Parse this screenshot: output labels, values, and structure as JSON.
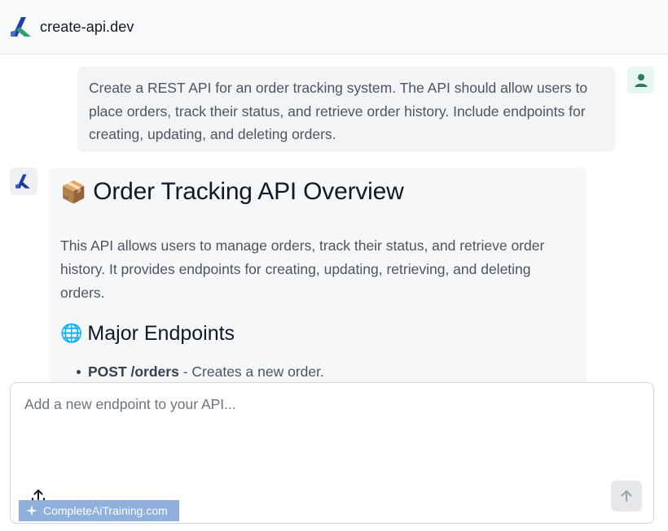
{
  "header": {
    "brand": "create-api.dev"
  },
  "conversation": {
    "user_message": "Create a REST API for an order tracking system. The API should allow users to place orders, track their status, and retrieve order history. Include endpoints for creating, updating, and deleting orders.",
    "assistant": {
      "title_emoji": "📦",
      "title": "Order Tracking API Overview",
      "description": "This API allows users to manage orders, track their status, and retrieve order history. It provides endpoints for creating, updating, retrieving, and deleting orders.",
      "section_emoji": "🌐",
      "section_title": "Major Endpoints",
      "endpoints": [
        {
          "method_path": "POST /orders",
          "desc": " - Creates a new order."
        }
      ]
    }
  },
  "composer": {
    "placeholder": "Add a new endpoint to your API...",
    "watermark": "CompleteAiTraining.com"
  },
  "icons": {
    "logo": "create-api-logo-icon",
    "user": "user-icon",
    "upload": "upload-icon",
    "send": "arrow-up-icon"
  },
  "colors": {
    "user_avatar_bg": "#e7f6ee",
    "user_icon": "#2f7a5c",
    "logo_blue": "#1e40af",
    "logo_green": "#2f9e77"
  }
}
